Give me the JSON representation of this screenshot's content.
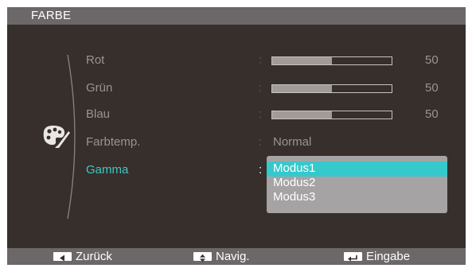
{
  "window": {
    "title": "FARBE"
  },
  "menu": {
    "items": [
      {
        "label": "Rot",
        "value": "50",
        "level": 0.5
      },
      {
        "label": "Grün",
        "value": "50",
        "level": 0.5
      },
      {
        "label": "Blau",
        "value": "50",
        "level": 0.5
      },
      {
        "label": "Farbtemp.",
        "value": "Normal"
      },
      {
        "label": "Gamma"
      }
    ],
    "colon": ":"
  },
  "gamma_dropdown": {
    "options": [
      "Modus1",
      "Modus2",
      "Modus3"
    ],
    "selected": "Modus1"
  },
  "footer": {
    "back_label": "Zurück",
    "nav_label": "Navig.",
    "enter_label": "Eingabe"
  },
  "icons": {
    "category": "palette-icon",
    "back": "left-arrow-icon",
    "nav": "up-down-arrow-icon",
    "enter": "enter-icon"
  },
  "colors": {
    "panel": "#362f2b",
    "bar": "#6c6869",
    "accent": "#35c9cb",
    "dropdown": "#a6a3a4"
  }
}
